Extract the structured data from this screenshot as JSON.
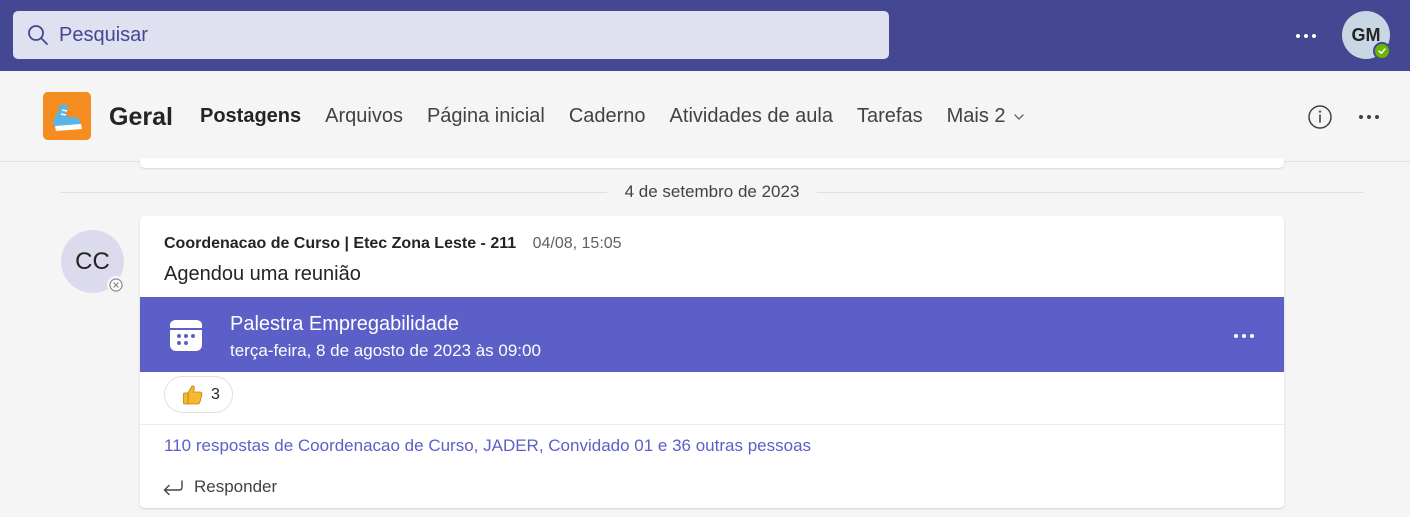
{
  "search": {
    "placeholder": "Pesquisar"
  },
  "topbar": {
    "user_initials": "GM",
    "presence": "available"
  },
  "channel": {
    "name": "Geral",
    "tabs": [
      {
        "label": "Postagens",
        "active": true
      },
      {
        "label": "Arquivos"
      },
      {
        "label": "Página inicial"
      },
      {
        "label": "Caderno"
      },
      {
        "label": "Atividades de aula"
      },
      {
        "label": "Tarefas"
      },
      {
        "label": "Mais 2"
      }
    ]
  },
  "feed": {
    "date_divider": "4 de setembro de 2023",
    "post": {
      "avatar_initials": "CC",
      "author": "Coordenacao de Curso | Etec Zona Leste - 211",
      "time": "04/08, 15:05",
      "message": "Agendou uma reunião",
      "meeting": {
        "title": "Palestra Empregabilidade",
        "datetime": "terça-feira, 8 de agosto de 2023 às 09:00"
      },
      "reaction": {
        "icon": "thumbs-up-icon",
        "count": "3"
      },
      "replies_summary": "110 respostas de Coordenacao de Curso, JADER, Convidado 01 e 36 outras pessoas",
      "reply_label": "Responder"
    }
  },
  "colors": {
    "topbar": "#444791",
    "accent": "#5b5fc7",
    "team_icon": "#f58c1f",
    "presence_available": "#6bb700"
  }
}
